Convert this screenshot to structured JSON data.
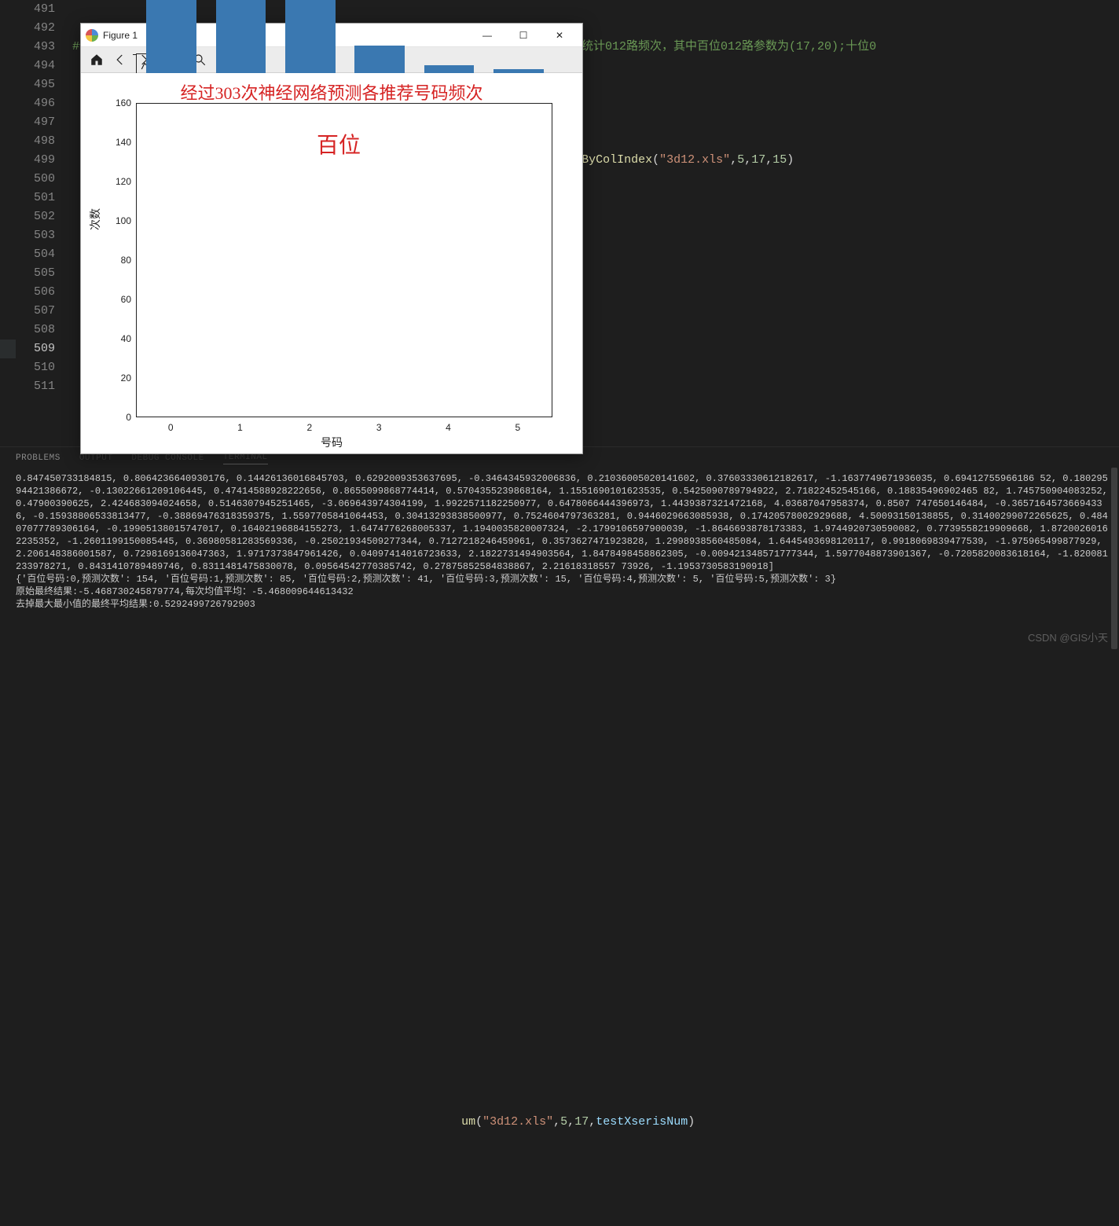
{
  "editor": {
    "line_numbers": [
      "491",
      "492",
      "493",
      "494",
      "495",
      "496",
      "497",
      "498",
      "499",
      "500",
      "501",
      "502",
      "503",
      "504",
      "505",
      "506",
      "507",
      "508",
      "509",
      "510",
      "511"
    ],
    "active_line": "509",
    "code": {
      "l491_comment": "#使用差分法来测试各号码频次迭代500次：百位(5,17);十位(6,23);个位(7,28)；迭代100次统计012路频次，其中百位012路参数为(17,20);十位0",
      "l493_left": "                                                          ",
      "l493_op": "=",
      "l493_func": "GetSeriesNumsByColIndex",
      "l493_paren_open": "(",
      "l493_str": "\"3d12.xls\"",
      "l493_c1": ",",
      "l493_n1": "5",
      "l493_c2": ",",
      "l493_n2": "17",
      "l493_c3": ",",
      "l493_n3": "15",
      "l493_paren_close": ")",
      "l510_left": "                                                       ",
      "l510_func": "um",
      "l510_paren_open": "(",
      "l510_str": "\"3d12.xls\"",
      "l510_c1": ",",
      "l510_n1": "5",
      "l510_c2": ",",
      "l510_n2": "17",
      "l510_c3": ",",
      "l510_var": "testXserisNum",
      "l510_paren_close": ")"
    }
  },
  "panel": {
    "tab_problems": "PROBLEMS",
    "tab_output_ghost": "OUTPUT",
    "tab_debug_ghost": "DEBUG CONSOLE",
    "tab_terminal_ghost": "TERMINAL"
  },
  "terminal": {
    "l1": "0.847450733184815, 0.8064236640930176, 0.14426136016845703, 0.6292009353637695, -0.3464345932006836, 0.21036005020141602, 0.37603330612182617, -1.1637749671936035, 0.69412755966186 52, 0.18029594421386672, -0.13022661209106445, 0.47414588928222656, 0.8655099868774414, 0.5704355239868164, 1.1551690101623535, 0.5425090789794922, 2.71822452545166, 0.18835496902465 82, 1.745750904083252, 0.47900390625, 2.424683094024658, 0.5146307945251465, -3.069643974304199, 1.9922571182250977, 0.6478066444396973, 1.4439387321472168, 4.03687047958374, 0.8507 747650146484, -0.36571645736694336, -0.15938806533813477, -0.38869476318359375, 1.5597705841064453, 0.30413293838500977, 0.7524604797363281, 0.9446029663085938, 0.17420578002929688, 4.50093150138855, 0.31400299072265625, 0.48407077789306164, -0.19905138015747017, 0.16402196884155273, 1.6474776268005337, 1.1940035820007324, -2.1799106597900039, -1.8646693878173383, 1.9744920730590082, 0.7739558219909668, 1.87200260162235352, -1.2601199150085445, 0.36980581283569336, -0.25021934509277344, 0.7127218246459961, 0.3573627471923828, 1.2998938560485084, 1.6445493698120117, 0.9918069839477539, -1.975965499877929, 2.206148386001587, 0.7298169136047363, 1.9717373847961426, 0.04097414016723633, 2.1822731494903564, 1.8478498458862305, -0.009421348571777344, 1.5977048873901367, -0.7205820083618164, -1.820081233978271, 0.8431410789489746, 0.8311481475830078, 0.09564542770385742, 0.27875852584838867, 2.21618318557 73926, -1.1953730583190918]",
    "l2": "{'百位号码:0,预测次数': 154, '百位号码:1,预测次数': 85, '百位号码:2,预测次数': 41, '百位号码:3,预测次数': 15, '百位号码:4,预测次数': 5, '百位号码:5,预测次数': 3}",
    "l3": "原始最终结果:-5.468730245879774,每次均值平均：-5.468009644613432",
    "l4": "去掉最大最小值的最终平均结果:0.5292499726792903"
  },
  "watermark": "CSDN @GIS小天",
  "figure_window": {
    "title": "Figure 1",
    "win_min": "—",
    "win_max": "☐",
    "win_close": "✕"
  },
  "chart_data": {
    "type": "bar",
    "title": "经过303次神经网络预测各推荐号码频次",
    "sub_label": "百位",
    "xlabel": "号码",
    "ylabel": "次数",
    "categories": [
      "0",
      "1",
      "2",
      "3",
      "4",
      "5"
    ],
    "values": [
      154,
      85,
      41,
      15,
      5,
      3
    ],
    "yticks": [
      0,
      20,
      40,
      60,
      80,
      100,
      120,
      140,
      160
    ],
    "ylim": [
      0,
      160
    ]
  }
}
